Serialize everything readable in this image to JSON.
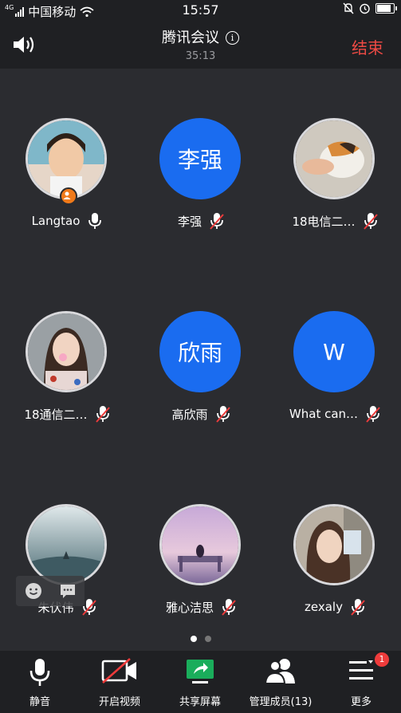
{
  "status_bar": {
    "carrier": "中国移动",
    "network": "4G",
    "time": "15:57"
  },
  "header": {
    "title": "腾讯会议",
    "duration": "35:13",
    "end_label": "结束"
  },
  "participants": [
    {
      "name": "Langtao",
      "avatar": "photo-girl",
      "mic": "on",
      "host": true
    },
    {
      "name": "李强",
      "avatar_text": "李强",
      "mic": "muted"
    },
    {
      "name": "18电信二…",
      "avatar": "photo-cat",
      "mic": "muted"
    },
    {
      "name": "18通信二…",
      "avatar": "photo-woman",
      "mic": "muted"
    },
    {
      "name": "高欣雨",
      "avatar_text": "欣雨",
      "mic": "muted"
    },
    {
      "name": "What can…",
      "avatar_text": "W",
      "mic": "muted"
    },
    {
      "name": "朱伏伟",
      "avatar": "photo-sea",
      "mic": "muted"
    },
    {
      "name": "雅心洁思",
      "avatar": "photo-dock",
      "mic": "muted"
    },
    {
      "name": "zexaly",
      "avatar": "photo-portrait",
      "mic": "muted"
    }
  ],
  "pagination": {
    "pages": 2,
    "current": 1
  },
  "toolbar": {
    "mute": "静音",
    "video": "开启视频",
    "share": "共享屏幕",
    "members": "管理成员(13)",
    "more": "更多",
    "more_badge": "1"
  },
  "colors": {
    "accent_blue": "#1a6cf0",
    "end_red": "#ee4a44",
    "share_green": "#1aad5b",
    "host_orange": "#f07a1a"
  }
}
